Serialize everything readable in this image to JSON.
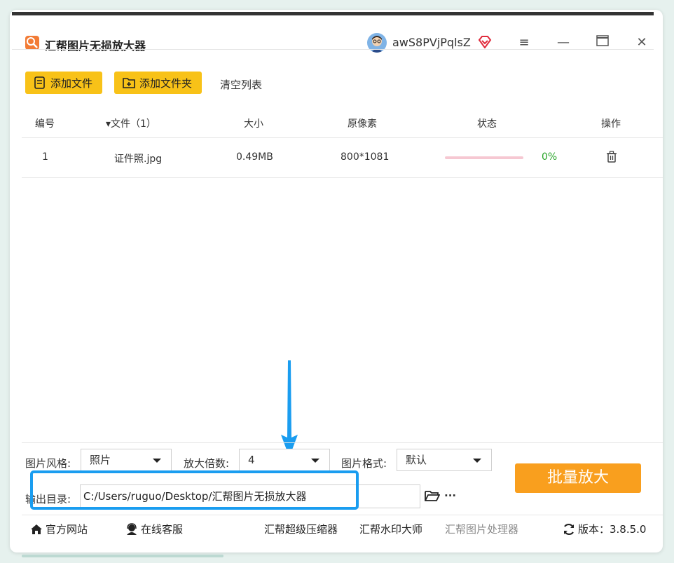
{
  "window": {
    "title": "汇帮图片无损放大器",
    "username": "awS8PVjPqlsZ",
    "controls": {
      "menu": "≡",
      "minimize": "—",
      "maximize": "☐",
      "close": "✕"
    }
  },
  "toolbar": {
    "add_file": "添加文件",
    "add_folder": "添加文件夹",
    "clear_list": "清空列表"
  },
  "table": {
    "headers": {
      "index": "编号",
      "file": "▾文件（1）",
      "size": "大小",
      "pixels": "原像素",
      "status": "状态",
      "action": "操作"
    },
    "rows": [
      {
        "index": "1",
        "file": "证件照.jpg",
        "size": "0.49MB",
        "pixels": "800*1081",
        "progress": 0,
        "percent": "0%"
      }
    ]
  },
  "settings": {
    "style_label": "图片风格:",
    "style_value": "照片",
    "scale_label": "放大倍数:",
    "scale_value": "4",
    "format_label": "图片格式:",
    "format_value": "默认",
    "output_label": "输出目录:",
    "output_path": "C:/Users/ruguo/Desktop/汇帮图片无损放大器",
    "more": "···",
    "batch_button": "批量放大"
  },
  "footer": {
    "website": "官方网站",
    "support": "在线客服",
    "compressor": "汇帮超级压缩器",
    "watermark": "汇帮水印大师",
    "processor": "汇帮图片处理器",
    "version": "版本：3.8.5.0"
  },
  "colors": {
    "accent_yellow": "#f8c218",
    "batch_orange": "#f99f1e",
    "highlight_blue": "#1a9df0",
    "progress_pink": "#f6c8d2",
    "percent_green": "#2aa52a"
  }
}
